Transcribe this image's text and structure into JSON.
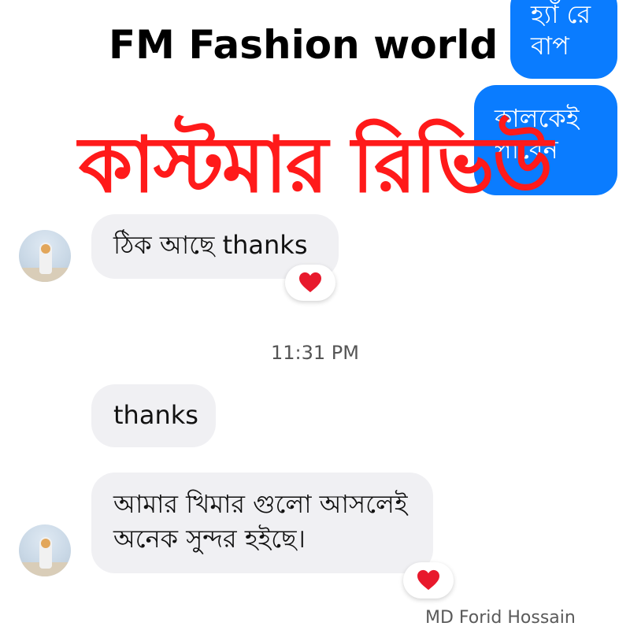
{
  "brand": "FM Fashion world",
  "headline": "কাস্টমার রিভিউ",
  "chat": {
    "outgoing": [
      {
        "text": "হ্যাঁ রে বাপ"
      },
      {
        "text": "কালকেই পাবেন"
      }
    ],
    "incoming": [
      {
        "text": "ঠিক আছে thanks",
        "reaction": "heart"
      },
      {
        "text": "thanks"
      },
      {
        "text": "আমার খিমার গুলো আসলেই অনেক সুন্দর হইছে।",
        "reaction": "heart"
      }
    ],
    "timestamp": "11:31 PM"
  },
  "watermark": "MD Forid Hossain",
  "colors": {
    "outgoing_bubble": "#0a7cff",
    "incoming_bubble": "#f0f0f3",
    "headline": "#ff1a1a",
    "heart": "#e8192c"
  }
}
